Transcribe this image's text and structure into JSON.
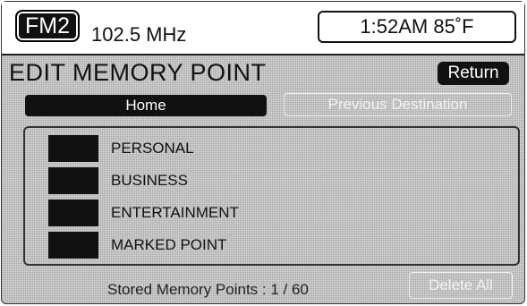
{
  "status_bar": {
    "band": "FM2",
    "frequency": "102.5 MHz",
    "clock_temp": "1:52AM 85˚F"
  },
  "screen_title": "EDIT MEMORY POINT",
  "return_label": "Return",
  "buttons": {
    "home": "Home",
    "previous_destination": "Previous Destination",
    "delete_all": "Delete All"
  },
  "categories": [
    {
      "label": "PERSONAL"
    },
    {
      "label": "BUSINESS"
    },
    {
      "label": "ENTERTAINMENT"
    },
    {
      "label": "MARKED POINT"
    }
  ],
  "stored_points_text": "Stored Memory Points  :  1 / 60",
  "colors": {
    "background": "#d6d6d6",
    "button_fill": "#111111",
    "disabled_text": "#f4f4f4"
  }
}
